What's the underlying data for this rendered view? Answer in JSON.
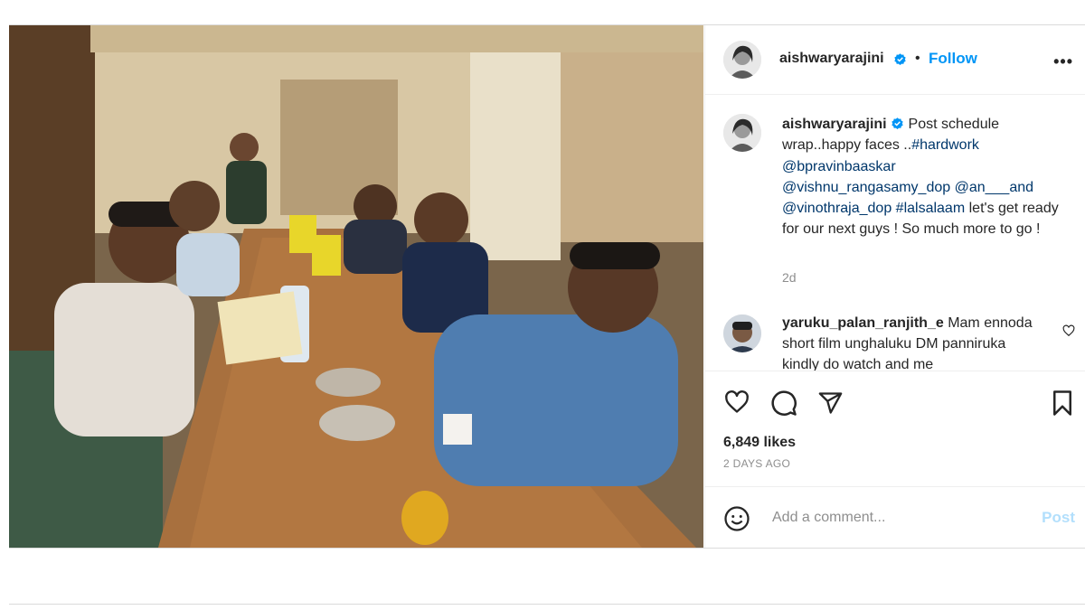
{
  "post": {
    "author": "aishwaryarajini",
    "follow_label": "Follow",
    "separator": "•",
    "more_label": "•••",
    "caption": {
      "username": "aishwaryarajini",
      "text_1": "Post schedule wrap..happy faces ..",
      "hashtag_1": "#hardwork",
      "mention_1": "@bpravinbaaskar",
      "mention_2": "@vishnu_rangasamy_dop",
      "mention_3": "@an___and",
      "mention_4": "@vinothraja_dop",
      "hashtag_2": "#lalsalaam",
      "text_2": "let's get ready for our next guys ! So much more to go !",
      "age": "2d"
    },
    "comment": {
      "username": "yaruku_palan_ranjith_e",
      "text": "Mam ennoda short film unghaluku DM panniruka kindly do watch and me"
    },
    "likes": "6,849 likes",
    "time_ago": "2 DAYS AGO",
    "add_comment_placeholder": "Add a comment...",
    "post_button": "Post"
  },
  "icons": {
    "like": "heart-icon",
    "comment": "comment-bubble-icon",
    "share": "paper-plane-icon",
    "save": "bookmark-icon",
    "emoji": "smiley-icon",
    "verified": "verified-badge-icon",
    "comment_like": "small-heart-icon"
  },
  "colors": {
    "link": "#0095f6",
    "mention": "#00376b",
    "muted": "#8e8e8e",
    "post_disabled": "#b2dffc",
    "verified": "#0095f6"
  }
}
